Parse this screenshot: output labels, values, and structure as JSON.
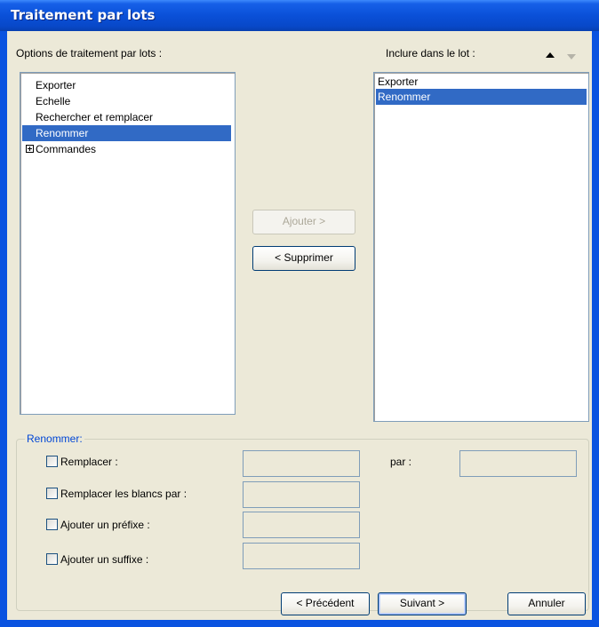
{
  "window": {
    "title": "Traitement par lots"
  },
  "options": {
    "label": "Options de traitement par lots :",
    "items": [
      "Exporter",
      "Echelle",
      "Rechercher et remplacer",
      "Renommer",
      "Commandes"
    ],
    "selected": "Renommer",
    "expandable": "Commandes"
  },
  "include": {
    "label": "Inclure dans le lot :",
    "items": [
      "Exporter",
      "Renommer"
    ],
    "selected": "Renommer",
    "move_up_icon": "arrow-up-icon",
    "move_down_icon": "arrow-down-icon"
  },
  "buttons": {
    "add": "Ajouter >",
    "remove": "< Supprimer",
    "previous": "< Précédent",
    "next": "Suivant >",
    "cancel": "Annuler"
  },
  "rename": {
    "group_title": "Renommer:",
    "replace_label": "Remplacer :",
    "replace_with_label": "par :",
    "replace_blanks_label": "Remplacer les blancs par :",
    "prefix_label": "Ajouter un préfixe :",
    "suffix_label": "Ajouter un suffixe :",
    "replace_value": "",
    "replace_with_value": "",
    "replace_blanks_value": "",
    "prefix_value": "",
    "suffix_value": ""
  },
  "colors": {
    "title_bar": "#0a50d8",
    "selection": "#316ac5",
    "group_title": "#0046d5",
    "dialog_bg": "#ece9d8"
  }
}
